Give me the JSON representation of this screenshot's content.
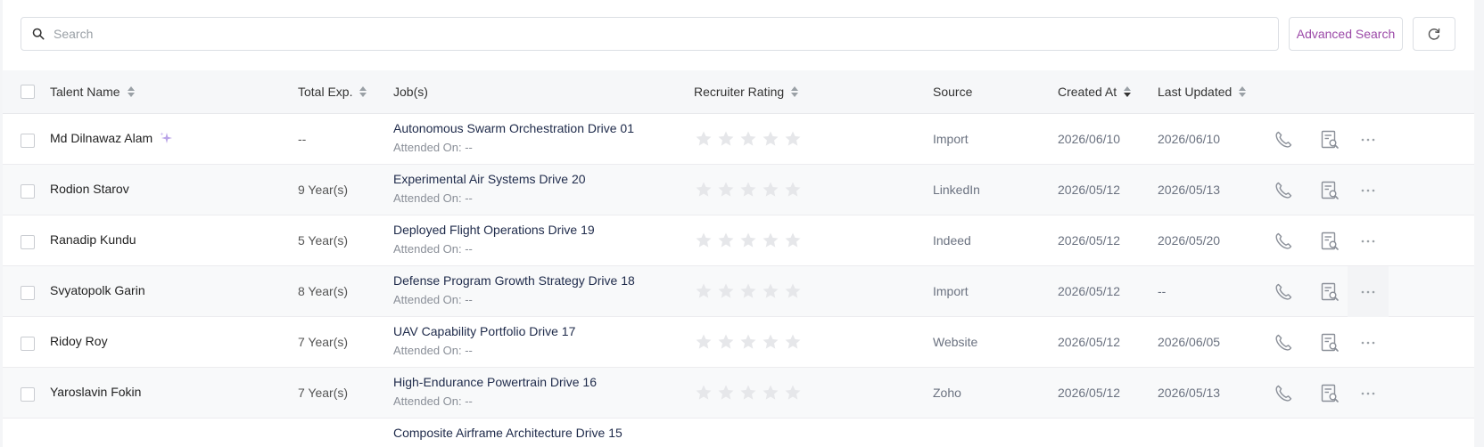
{
  "toolbar": {
    "search_placeholder": "Search",
    "advanced_search_label": "Advanced Search",
    "accent_color": "#9c4aa8"
  },
  "table": {
    "headers": {
      "talent_name": "Talent Name",
      "total_exp": "Total Exp.",
      "jobs": "Job(s)",
      "recruiter_rating": "Recruiter Rating",
      "source": "Source",
      "created_at": "Created At",
      "last_updated": "Last Updated"
    },
    "rows": [
      {
        "name": "Md Dilnawaz Alam",
        "ai_badge": true,
        "exp": "--",
        "job": "Autonomous Swarm Orchestration Drive 01",
        "attended": "Attended On: --",
        "rating": 0,
        "source": "Import",
        "created": "2026/06/10",
        "updated": "2026/06/10"
      },
      {
        "name": "Rodion Starov",
        "ai_badge": false,
        "exp": "9 Year(s)",
        "job": "Experimental Air Systems Drive 20",
        "attended": "Attended On: --",
        "rating": 0,
        "source": "LinkedIn",
        "created": "2026/05/12",
        "updated": "2026/05/13"
      },
      {
        "name": "Ranadip Kundu",
        "ai_badge": false,
        "exp": "5 Year(s)",
        "job": "Deployed Flight Operations Drive 19",
        "attended": "Attended On: --",
        "rating": 0,
        "source": "Indeed",
        "created": "2026/05/12",
        "updated": "2026/05/20"
      },
      {
        "name": "Svyatopolk Garin",
        "ai_badge": false,
        "exp": "8 Year(s)",
        "job": "Defense Program Growth Strategy Drive 18",
        "attended": "Attended On: --",
        "rating": 0,
        "source": "Import",
        "created": "2026/05/12",
        "updated": "--"
      },
      {
        "name": "Ridoy Roy",
        "ai_badge": false,
        "exp": "7 Year(s)",
        "job": "UAV Capability Portfolio Drive 17",
        "attended": "Attended On: --",
        "rating": 0,
        "source": "Website",
        "created": "2026/05/12",
        "updated": "2026/06/05"
      },
      {
        "name": "Yaroslavin Fokin",
        "ai_badge": false,
        "exp": "7 Year(s)",
        "job": "High-Endurance Powertrain Drive 16",
        "attended": "Attended On: --",
        "rating": 0,
        "source": "Zoho",
        "created": "2026/05/12",
        "updated": "2026/05/13"
      },
      {
        "name": "",
        "ai_badge": false,
        "exp": "",
        "job": "Composite Airframe Architecture Drive 15",
        "attended": "",
        "rating": 0,
        "source": "",
        "created": "",
        "updated": ""
      }
    ]
  },
  "icons": {
    "search": "search-icon",
    "refresh": "refresh-icon",
    "sort": "sort-icon",
    "ai_badge": "sparkle-icon",
    "star": "star-icon",
    "call": "phone-icon",
    "resume": "resume-search-icon",
    "more": "more-horizontal-icon"
  }
}
